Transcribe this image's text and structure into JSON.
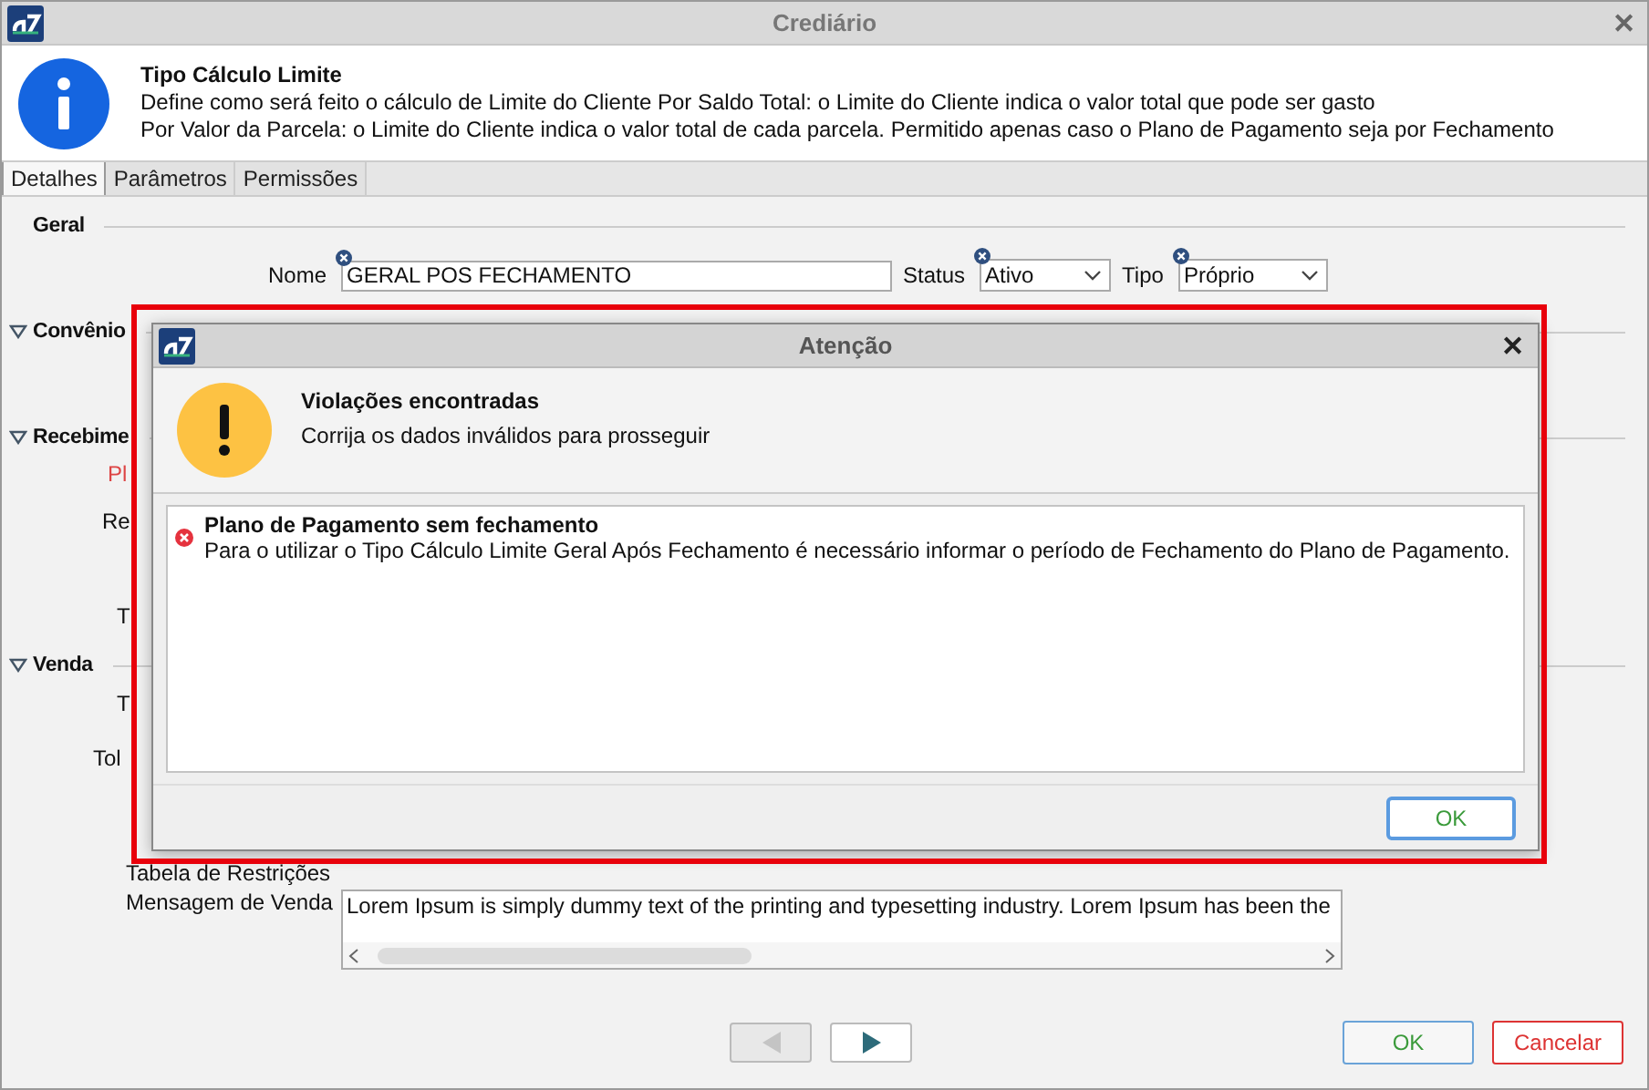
{
  "window": {
    "title": "Crediário",
    "close": "✕"
  },
  "info": {
    "title": "Tipo Cálculo Limite",
    "lines": [
      "Define como será feito o cálculo de Limite do Cliente Por Saldo Total: o Limite do Cliente indica o valor total que pode ser gasto",
      "Por Valor da Parcela: o Limite do Cliente indica o valor total de cada parcela. Permitido apenas caso o Plano de Pagamento seja por Fechamento"
    ]
  },
  "tabs": [
    {
      "label": "Detalhes",
      "selected": true
    },
    {
      "label": "Parâmetros",
      "selected": false
    },
    {
      "label": "Permissões",
      "selected": false
    }
  ],
  "sections": [
    {
      "title": "Geral",
      "collapsible": false,
      "fields": [
        {
          "label": "Nome",
          "kind": "text",
          "value": "GERAL POS FECHAMENTO"
        },
        {
          "label": "Status",
          "kind": "select",
          "value": "Ativo"
        },
        {
          "label": "Tipo",
          "kind": "select",
          "value": "Próprio"
        }
      ]
    },
    {
      "title": "Convênio",
      "collapsible": true
    },
    {
      "title": "Recebime",
      "collapsible": true,
      "labels": [
        {
          "text": "Pl",
          "invalid": true
        },
        {
          "text": "Re",
          "invalid": false
        },
        {
          "text": "T",
          "invalid": false
        }
      ]
    },
    {
      "title": "Venda",
      "collapsible": true,
      "labels": [
        {
          "text": "T",
          "invalid": false
        },
        {
          "text": "Tol",
          "invalid": false
        }
      ]
    }
  ],
  "restrictions": {
    "label": "Tabela de Restrições"
  },
  "message": {
    "label": "Mensagem de Venda",
    "value": "Lorem Ipsum is simply dummy text of the printing and typesetting industry. Lorem Ipsum has been the"
  },
  "nav": [
    {
      "kind": "prev",
      "disabled": true
    },
    {
      "kind": "next",
      "disabled": false
    }
  ],
  "buttons": [
    {
      "label": "OK",
      "kind": "ok"
    },
    {
      "label": "Cancelar",
      "kind": "cancel"
    }
  ],
  "dialog": {
    "title": "Atenção",
    "close": "✕",
    "highlighted": true,
    "heading": "Violações encontradas",
    "message": "Corrija os dados inválidos para prosseguir",
    "violations": [
      {
        "title": "Plano de Pagamento sem fechamento",
        "detail": "Para o utilizar o Tipo Cálculo Limite Geral Após Fechamento é necessário informar o período de Fechamento do Plano de Pagamento."
      }
    ],
    "button": "OK"
  }
}
